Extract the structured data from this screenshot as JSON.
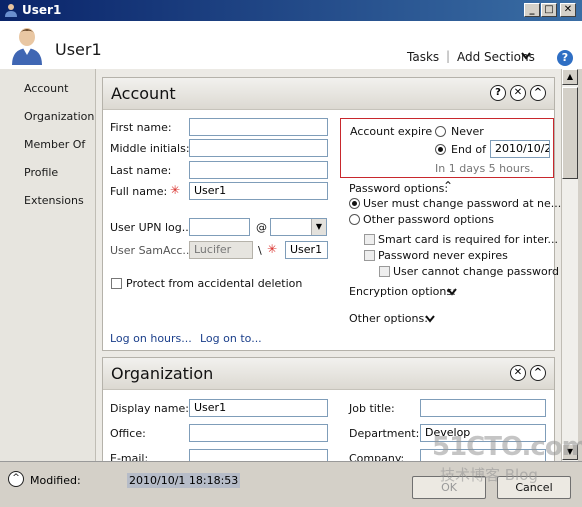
{
  "window": {
    "title": "User1"
  },
  "header": {
    "user_name": "User1",
    "tasks_label": "Tasks",
    "separator": "|",
    "add_sections_label": "Add Sections",
    "help_glyph": "?"
  },
  "nav": {
    "items": [
      {
        "label": "Account"
      },
      {
        "label": "Organization"
      },
      {
        "label": "Member Of"
      },
      {
        "label": "Profile"
      },
      {
        "label": "Extensions"
      }
    ]
  },
  "account": {
    "title": "Account",
    "first_name_label": "First name:",
    "first_name_value": "",
    "middle_initials_label": "Middle initials:",
    "middle_initials_value": "",
    "last_name_label": "Last name:",
    "last_name_value": "",
    "full_name_label": "Full name:",
    "full_name_value": "User1",
    "upn_label": "User UPN log...",
    "upn_value": "",
    "at_symbol": "@",
    "upn_domain_value": "",
    "sam_label": "User SamAcc...",
    "sam_domain_value": "Lucifer",
    "sam_separator": "\\",
    "sam_value": "User1",
    "protect_label": "Protect from accidental deletion",
    "protect_checked": false,
    "log_on_hours_link": "Log on hours...",
    "log_on_to_link": "Log on to...",
    "account_expires_label": "Account expire",
    "never_label": "Never",
    "end_of_label": "End of",
    "end_of_date": "2010/10/2",
    "expires_hint": "In 1 days 5 hours.",
    "password_options_label": "Password options:",
    "must_change_label": "User must change password at ne...",
    "other_password_label": "Other password options",
    "smart_card_label": "Smart card is required for inter...",
    "never_expires_label": "Password never expires",
    "cannot_change_label": "User cannot change password",
    "encryption_options_label": "Encryption options:",
    "other_options_label": "Other options:"
  },
  "organization": {
    "title": "Organization",
    "display_name_label": "Display name:",
    "display_name_value": "User1",
    "office_label": "Office:",
    "office_value": "",
    "email_label": "E-mail:",
    "email_value": "",
    "job_title_label": "Job title:",
    "job_title_value": "",
    "department_label": "Department:",
    "department_value": "Develop",
    "company_label": "Company:",
    "company_value": ""
  },
  "footer": {
    "modified_label": "Modified:",
    "modified_value": "2010/10/1 18:18:53",
    "ok_label": "OK",
    "cancel_label": "Cancel"
  },
  "watermark": {
    "line1": "51CTO.com",
    "line2": "技术博客  Blog"
  },
  "colors": {
    "titlebar": "#0a246a",
    "expire_border": "#c8282d",
    "required_star": "#d9302c",
    "link": "#1b3f8b"
  },
  "icons": [
    "user-avatar-icon",
    "help-icon",
    "chevron-down-icon",
    "chevron-up-icon",
    "close-icon",
    "minimize-icon",
    "maximize-icon"
  ]
}
